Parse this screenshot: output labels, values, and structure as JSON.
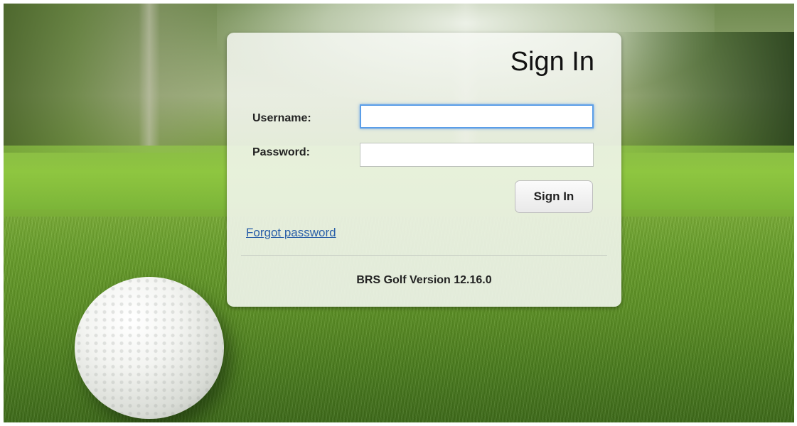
{
  "login": {
    "title": "Sign In",
    "username_label": "Username:",
    "username_value": "",
    "password_label": "Password:",
    "password_value": "",
    "submit_label": "Sign In",
    "forgot_password_label": "Forgot password"
  },
  "footer": {
    "version_text": "BRS Golf Version 12.16.0"
  },
  "colors": {
    "focus_ring": "#5b9ee8",
    "link": "#2a5fa8"
  },
  "background": {
    "scene": "golf-ball-on-green",
    "icon": "golf-ball-icon"
  }
}
